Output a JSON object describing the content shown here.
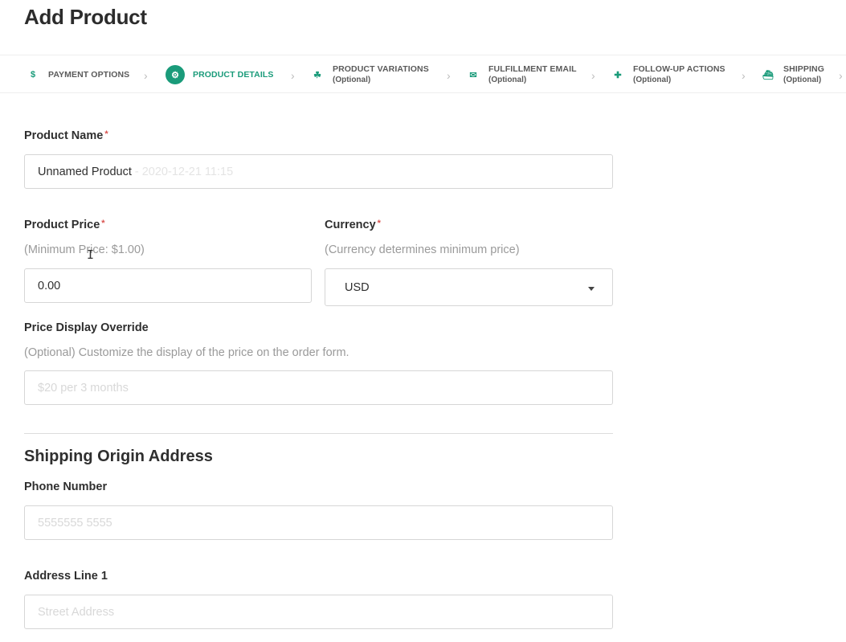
{
  "page": {
    "title": "Add Product"
  },
  "steps": [
    {
      "label": "PAYMENT OPTIONS",
      "sub": "",
      "icon": "dollar-icon",
      "glyph": "$"
    },
    {
      "label": "PRODUCT DETAILS",
      "sub": "",
      "icon": "gears-icon",
      "glyph": "⚙"
    },
    {
      "label": "PRODUCT VARIATIONS",
      "sub": "(Optional)",
      "icon": "cubes-icon",
      "glyph": "☘"
    },
    {
      "label": "FULFILLMENT EMAIL",
      "sub": "(Optional)",
      "icon": "envelope-icon",
      "glyph": "✉"
    },
    {
      "label": "FOLLOW-UP ACTIONS",
      "sub": "(Optional)",
      "icon": "puzzle-icon",
      "glyph": "✚"
    },
    {
      "label": "SHIPPING",
      "sub": "(Optional)",
      "icon": "ship-icon",
      "glyph": "⛴"
    }
  ],
  "form": {
    "product_name": {
      "label": "Product Name",
      "required": "*",
      "value": "Unnamed Product",
      "ghost": "- 2020-12-21 11:15"
    },
    "product_price": {
      "label": "Product Price",
      "required": "*",
      "hint": "(Minimum Price: $1.00)",
      "value": "0.00"
    },
    "currency": {
      "label": "Currency",
      "required": "*",
      "hint": "(Currency determines minimum price)",
      "value": "USD"
    },
    "price_display_override": {
      "label": "Price Display Override",
      "hint": "(Optional) Customize the display of the price on the order form.",
      "placeholder": "$20 per 3 months"
    },
    "shipping_section_title": "Shipping Origin Address",
    "phone_number": {
      "label": "Phone Number",
      "placeholder": "5555555 5555"
    },
    "address_line_1": {
      "label": "Address Line 1",
      "placeholder": "Street Address"
    }
  }
}
